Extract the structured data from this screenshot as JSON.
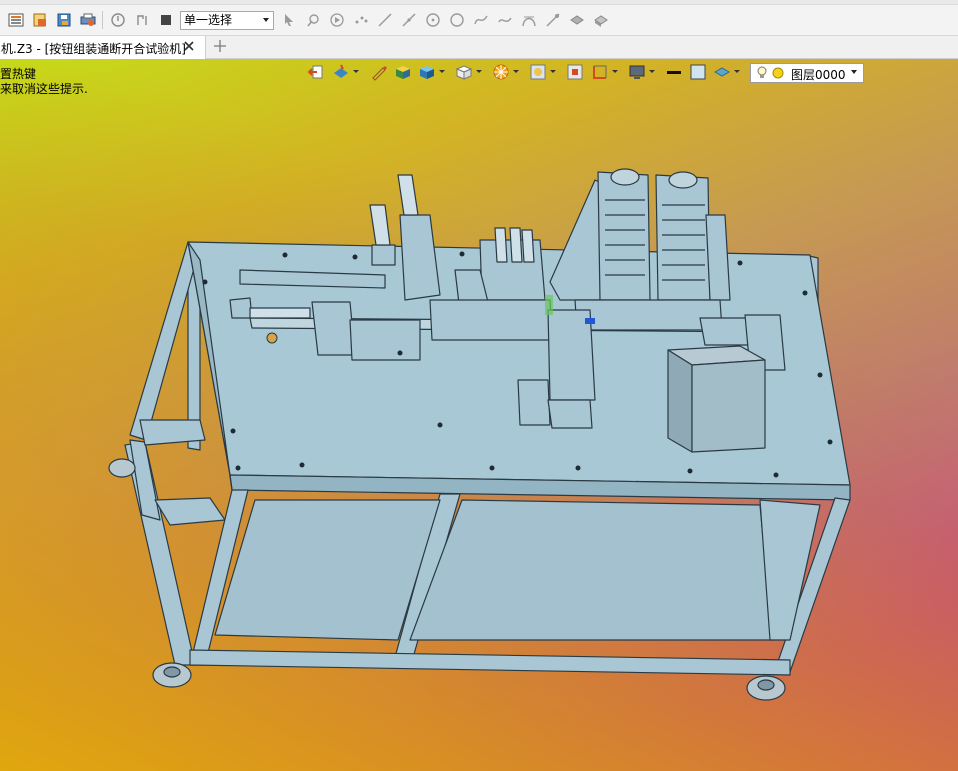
{
  "toolbar": {
    "selection_filter": "单一选择"
  },
  "tab": {
    "label": "机.Z3 - [按钮组装通断开合试验机]",
    "add_label": "+"
  },
  "viewport": {
    "hint_title": "置热键",
    "hint_text": "来取消这些提示.",
    "layer": "图层0000"
  },
  "colors": {
    "model_fill": "#a8c6d4",
    "model_stroke": "#2a3a44",
    "toolbar_bg": "#f3f3f3"
  }
}
